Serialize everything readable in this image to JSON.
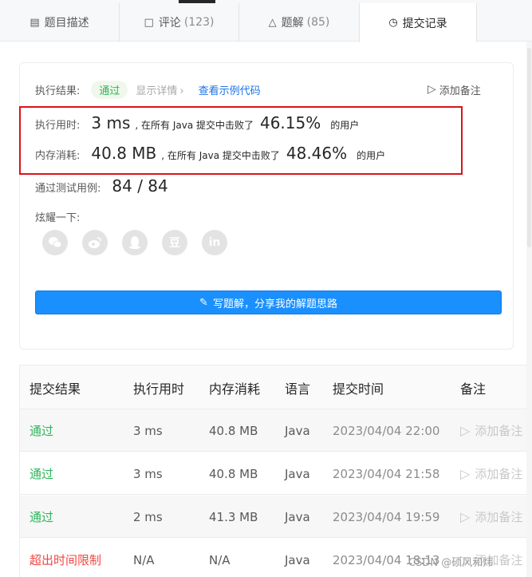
{
  "tabs": [
    {
      "label": "题目描述",
      "count": ""
    },
    {
      "label": "评论",
      "count": "(123)"
    },
    {
      "label": "题解",
      "count": "(85)"
    },
    {
      "label": "提交记录",
      "count": ""
    }
  ],
  "result": {
    "label": "执行结果:",
    "status": "通过",
    "detail": "显示详情",
    "sample_code": "查看示例代码",
    "add_note": "添加备注"
  },
  "runtime": {
    "label": "执行用时:",
    "value": "3 ms",
    "mid": ", 在所有 Java 提交中击败了",
    "percent": "46.15%",
    "users": "的用户"
  },
  "memory": {
    "label": "内存消耗:",
    "value": "40.8 MB",
    "mid": ", 在所有 Java 提交中击败了",
    "percent": "48.46%",
    "users": "的用户"
  },
  "tests": {
    "label": "通过测试用例:",
    "value": "84 / 84"
  },
  "share": {
    "label": "炫耀一下:",
    "icons": [
      "wechat-icon",
      "weibo-icon",
      "qq-icon",
      "douban-icon",
      "linkedin-icon"
    ],
    "douban_glyph": "豆",
    "linkedin_glyph": "in"
  },
  "write_button": "写题解，分享我的解题思路",
  "table": {
    "headers": [
      "提交结果",
      "执行用时",
      "内存消耗",
      "语言",
      "提交时间",
      "备注"
    ],
    "rows": [
      {
        "status": "通过",
        "runtime": "3 ms",
        "memory": "40.8 MB",
        "lang": "Java",
        "time": "2023/04/04 22:00",
        "note": "添加备注"
      },
      {
        "status": "通过",
        "runtime": "3 ms",
        "memory": "40.8 MB",
        "lang": "Java",
        "time": "2023/04/04 21:58",
        "note": "添加备注"
      },
      {
        "status": "通过",
        "runtime": "2 ms",
        "memory": "41.3 MB",
        "lang": "Java",
        "time": "2023/04/04 19:59",
        "note": "添加备注"
      },
      {
        "status": "超出时间限制",
        "runtime": "N/A",
        "memory": "N/A",
        "lang": "Java",
        "time": "2023/04/04 18:13",
        "note": "添加备注"
      }
    ]
  },
  "watermark": "CSDN @硕风和炜",
  "colors": {
    "accent": "#1a90ff",
    "success": "#2db55d",
    "error": "#ef4743",
    "highlight_border": "#d9141c"
  }
}
